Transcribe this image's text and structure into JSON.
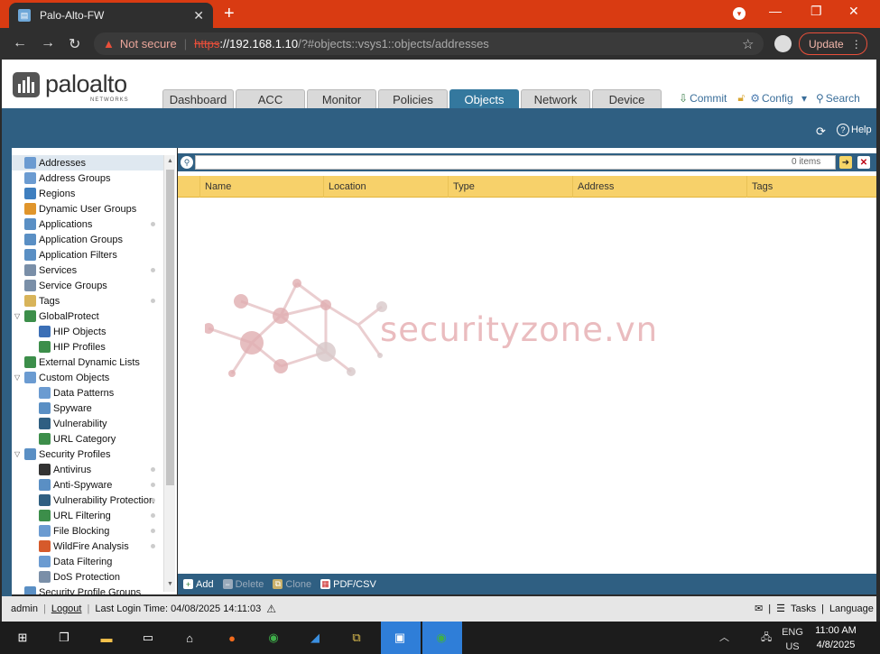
{
  "browser": {
    "tab_title": "Palo-Alto-FW",
    "close_glyph": "✕",
    "newtab_glyph": "+",
    "not_secure": "Not secure",
    "url_scheme": "https",
    "url_host": "://192.168.1.10",
    "url_path": "/?#objects::vsys1::objects/addresses",
    "update_label": "Update"
  },
  "header": {
    "brand": "paloalto",
    "sub_brand": "NETWORKS",
    "tabs": [
      {
        "label": "Dashboard",
        "w": 79
      },
      {
        "label": "ACC",
        "w": 77
      },
      {
        "label": "Monitor",
        "w": 77
      },
      {
        "label": "Policies",
        "w": 77
      },
      {
        "label": "Objects",
        "w": 77,
        "active": true
      },
      {
        "label": "Network",
        "w": 77
      },
      {
        "label": "Device",
        "w": 77
      }
    ],
    "commit": "Commit",
    "config": "Config",
    "search": "Search",
    "help": "Help"
  },
  "sidebar": {
    "items": [
      {
        "label": "Addresses",
        "level": 1,
        "icon": "address-icon",
        "color": "#6b9bd1",
        "selected": true
      },
      {
        "label": "Address Groups",
        "level": 1,
        "icon": "address-groups-icon",
        "color": "#6b9bd1"
      },
      {
        "label": "Regions",
        "level": 1,
        "icon": "globe-icon",
        "color": "#3f7fbf"
      },
      {
        "label": "Dynamic User Groups",
        "level": 1,
        "icon": "users-icon",
        "color": "#e0952b"
      },
      {
        "label": "Applications",
        "level": 1,
        "icon": "applications-icon",
        "color": "#5a8fc4",
        "bullet": true
      },
      {
        "label": "Application Groups",
        "level": 1,
        "icon": "application-groups-icon",
        "color": "#5a8fc4"
      },
      {
        "label": "Application Filters",
        "level": 1,
        "icon": "application-filters-icon",
        "color": "#5a8fc4"
      },
      {
        "label": "Services",
        "level": 1,
        "icon": "services-icon",
        "color": "#7a8fa8",
        "bullet": true
      },
      {
        "label": "Service Groups",
        "level": 1,
        "icon": "service-groups-icon",
        "color": "#7a8fa8"
      },
      {
        "label": "Tags",
        "level": 1,
        "icon": "tag-icon",
        "color": "#d8b45a",
        "bullet": true
      },
      {
        "label": "GlobalProtect",
        "level": 0,
        "icon": "globalprotect-icon",
        "color": "#3c8e4a",
        "expander": "▽"
      },
      {
        "label": "HIP Objects",
        "level": 2,
        "icon": "hip-objects-icon",
        "color": "#3b6fb6"
      },
      {
        "label": "HIP Profiles",
        "level": 2,
        "icon": "hip-profiles-icon",
        "color": "#3c8e4a"
      },
      {
        "label": "External Dynamic Lists",
        "level": 1,
        "icon": "external-lists-icon",
        "color": "#3c8e4a"
      },
      {
        "label": "Custom Objects",
        "level": 0,
        "icon": "custom-objects-icon",
        "color": "#6b9bd1",
        "expander": "▽"
      },
      {
        "label": "Data Patterns",
        "level": 2,
        "icon": "data-patterns-icon",
        "color": "#6b9bd1"
      },
      {
        "label": "Spyware",
        "level": 2,
        "icon": "spyware-icon",
        "color": "#5a8fc4"
      },
      {
        "label": "Vulnerability",
        "level": 2,
        "icon": "vulnerability-icon",
        "color": "#2f5f82"
      },
      {
        "label": "URL Category",
        "level": 2,
        "icon": "url-category-icon",
        "color": "#3c8e4a"
      },
      {
        "label": "Security Profiles",
        "level": 0,
        "icon": "security-profiles-icon",
        "color": "#5a8fc4",
        "expander": "▽"
      },
      {
        "label": "Antivirus",
        "level": 2,
        "icon": "antivirus-icon",
        "color": "#333",
        "bullet": true
      },
      {
        "label": "Anti-Spyware",
        "level": 2,
        "icon": "anti-spyware-icon",
        "color": "#5a8fc4",
        "bullet": true
      },
      {
        "label": "Vulnerability Protection",
        "level": 2,
        "icon": "vulnerability-protection-icon",
        "color": "#2f5f82",
        "bullet": true
      },
      {
        "label": "URL Filtering",
        "level": 2,
        "icon": "url-filtering-icon",
        "color": "#3c8e4a",
        "bullet": true
      },
      {
        "label": "File Blocking",
        "level": 2,
        "icon": "file-blocking-icon",
        "color": "#6b9bd1",
        "bullet": true
      },
      {
        "label": "WildFire Analysis",
        "level": 2,
        "icon": "wildfire-icon",
        "color": "#d65a2b",
        "bullet": true
      },
      {
        "label": "Data Filtering",
        "level": 2,
        "icon": "data-filtering-icon",
        "color": "#6b9bd1"
      },
      {
        "label": "DoS Protection",
        "level": 2,
        "icon": "dos-protection-icon",
        "color": "#7a8fa8"
      },
      {
        "label": "Security Profile Groups",
        "level": 1,
        "icon": "security-profile-groups-icon",
        "color": "#5a8fc4"
      }
    ]
  },
  "grid": {
    "search_value": "",
    "item_count": "0 items",
    "columns": [
      {
        "label": "Name",
        "w": 137
      },
      {
        "label": "Location",
        "w": 138
      },
      {
        "label": "Type",
        "w": 138
      },
      {
        "label": "Address",
        "w": 193
      },
      {
        "label": "Tags",
        "w": 144
      }
    ]
  },
  "watermark": "securityzone.vn",
  "actions": {
    "add": "Add",
    "delete": "Delete",
    "clone": "Clone",
    "pdf": "PDF/CSV"
  },
  "status": {
    "user": "admin",
    "logout": "Logout",
    "last_login": "Last Login Time: 04/08/2025 14:11:03",
    "tasks": "Tasks",
    "language": "Language"
  },
  "taskbar": {
    "lang_top": "ENG",
    "lang_bottom": "US",
    "time": "11:00 AM",
    "date": "4/8/2025"
  },
  "colors": {
    "chrome_red": "#d93b12",
    "pa_blue": "#2f5f82",
    "tab_active": "#34789e",
    "grid_header": "#f7d16a"
  }
}
